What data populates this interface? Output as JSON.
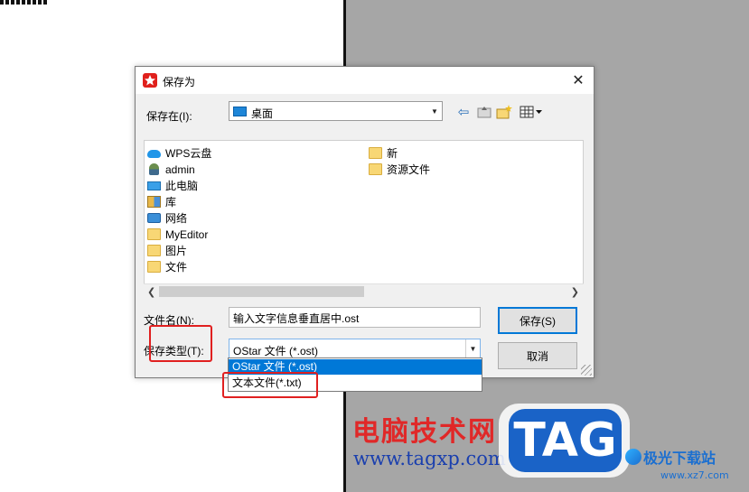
{
  "dialog": {
    "title": "保存为",
    "close_glyph": "✕",
    "save_in_label": "保存在(I):",
    "location": "桌面",
    "toolbar_icons": [
      "back-arrow-icon",
      "up-folder-icon",
      "new-folder-icon",
      "view-menu-icon"
    ]
  },
  "files": [
    {
      "name": "WPS云盘",
      "icon": "cloud-icon"
    },
    {
      "name": "admin",
      "icon": "user-icon"
    },
    {
      "name": "此电脑",
      "icon": "computer-icon"
    },
    {
      "name": "库",
      "icon": "library-icon"
    },
    {
      "name": "网络",
      "icon": "network-icon"
    },
    {
      "name": "MyEditor",
      "icon": "folder-icon"
    },
    {
      "name": "图片",
      "icon": "folder-icon"
    },
    {
      "name": "文件",
      "icon": "folder-icon"
    },
    {
      "name": "新",
      "icon": "folder-icon"
    },
    {
      "name": "资源文件",
      "icon": "folder-icon"
    }
  ],
  "filename_label": "文件名(N):",
  "filename_value": "输入文字信息垂直居中.ost",
  "filetype_label": "保存类型(T):",
  "filetype_value": "OStar 文件 (*.ost)",
  "buttons": {
    "save": "保存(S)",
    "cancel": "取消"
  },
  "dropdown_options": [
    "OStar 文件 (*.ost)",
    "文本文件(*.txt)"
  ],
  "watermark": {
    "cn": "电脑技术网",
    "url": "www.tagxp.com",
    "tag": "TAG",
    "site": "极光下载站",
    "site_url": "www.xz7.com"
  },
  "colors": {
    "selection": "#0078d7",
    "highlight_box": "#e02020",
    "canvas_gray": "#a6a6a6"
  }
}
